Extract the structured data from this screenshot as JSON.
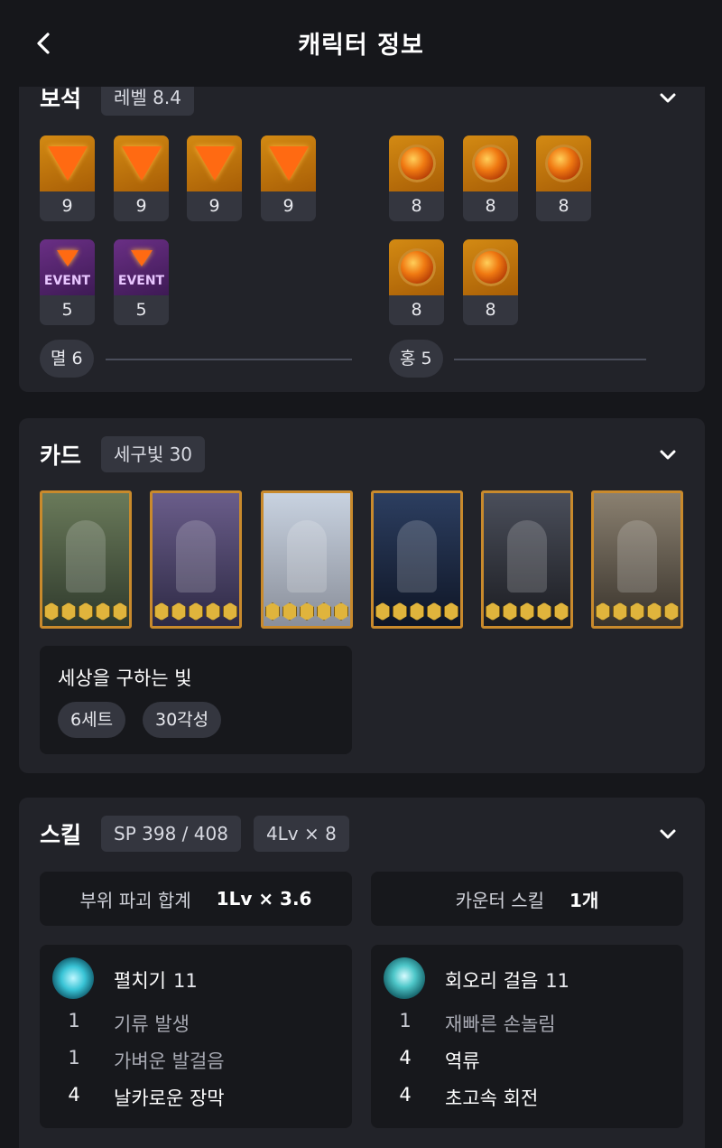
{
  "header": {
    "title": "캐릭터 정보"
  },
  "gems": {
    "title": "보석",
    "level_pill": "레벨 8.4",
    "left_top": [
      "9",
      "9",
      "9",
      "9"
    ],
    "left_bottom": [
      "5",
      "5"
    ],
    "event_label": "EVENT",
    "right_top": [
      "8",
      "8",
      "8"
    ],
    "right_bottom": [
      "8",
      "8"
    ],
    "left_set": "멸 6",
    "right_set": "홍 5"
  },
  "cards": {
    "title": "카드",
    "set_pill": "세구빛 30",
    "set_name": "세상을 구하는 빛",
    "chips": [
      "6세트",
      "30각성"
    ],
    "items": [
      {
        "bg": [
          "#6a7a5a",
          "#2f3a2c"
        ]
      },
      {
        "bg": [
          "#6a5d8a",
          "#2e2a45"
        ]
      },
      {
        "bg": [
          "#c8d2e0",
          "#8a8f9a"
        ]
      },
      {
        "bg": [
          "#2c3e60",
          "#0f1626"
        ]
      },
      {
        "bg": [
          "#4a4e5a",
          "#1c1d22"
        ]
      },
      {
        "bg": [
          "#8a8070",
          "#3a342c"
        ]
      }
    ]
  },
  "skills": {
    "title": "스킬",
    "sp_pill": "SP 398 / 408",
    "lv_pill": "4Lv × 8",
    "destruction_label": "부위 파괴 합계",
    "destruction_value": "1Lv × 3.6",
    "counter_label": "카운터 스킬",
    "counter_value": "1개",
    "list": [
      {
        "name": "펼치기",
        "level": "11",
        "tripods": [
          {
            "n": "1",
            "t": "기류 발생",
            "hi": false
          },
          {
            "n": "1",
            "t": "가벼운 발걸음",
            "hi": false
          },
          {
            "n": "4",
            "t": "날카로운 장막",
            "hi": true
          }
        ]
      },
      {
        "name": "회오리 걸음",
        "level": "11",
        "tripods": [
          {
            "n": "1",
            "t": "재빠른 손놀림",
            "hi": false
          },
          {
            "n": "4",
            "t": "역류",
            "hi": true
          },
          {
            "n": "4",
            "t": "초고속 회전",
            "hi": true
          }
        ]
      }
    ]
  }
}
